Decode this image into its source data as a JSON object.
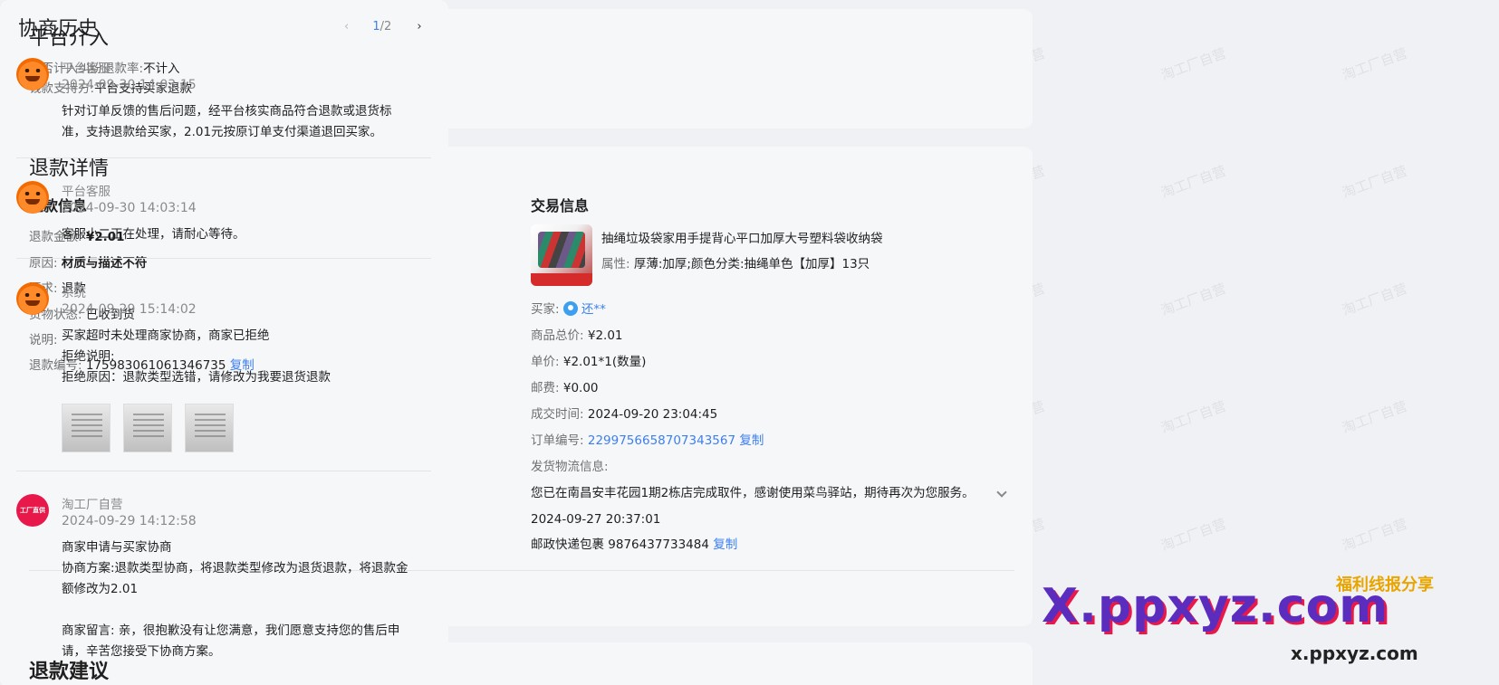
{
  "platform": {
    "title": "平台介入",
    "rows": [
      {
        "label": "是否计入纠纷退款率:",
        "value": "不计入"
      },
      {
        "label": "钱款支持方:",
        "value": "平台支持买家退款"
      }
    ]
  },
  "refund": {
    "title": "退款详情",
    "info_title": "退款信息",
    "info": {
      "amount_label": "退款金额:",
      "amount": "¥2.01",
      "reason_label": "原因:",
      "reason": "材质与描述不符",
      "request_label": "要求:",
      "request": "退款",
      "goods_label": "货物状态:",
      "goods": "已收到货",
      "note_label": "说明:",
      "note": "",
      "refund_no_label": "退款编号:",
      "refund_no": "175983061061346735",
      "copy": "复制"
    },
    "trade_title": "交易信息",
    "trade": {
      "product_name": "抽绳垃圾袋家用手提背心平口加厚大号塑料袋收纳袋",
      "attr_label": "属性:",
      "attr": "厚薄:加厚;颜色分类:抽绳单色【加厚】13只",
      "buyer_label": "买家:",
      "buyer": "还**",
      "total_label": "商品总价:",
      "total": "¥2.01",
      "unit_label": "单价:",
      "unit": "¥2.01*1(数量)",
      "shipping_label": "邮费:",
      "shipping": "¥0.00",
      "deal_time_label": "成交时间:",
      "deal_time": "2024-09-20 23:04:45",
      "order_no_label": "订单编号:",
      "order_no": "2299756658707343567",
      "copy": "复制",
      "logistics_label": "发货物流信息:",
      "logistics_msg": "您已在南昌安丰花园1期2栋店完成取件，感谢使用菜鸟驿站，期待再次为您服务。",
      "logistics_time": "2024-09-27 20:37:01",
      "tracking": "邮政快递包裹 9876437733484",
      "tracking_copy": "复制"
    }
  },
  "advice": {
    "title": "退款建议"
  },
  "history": {
    "title": "协商历史",
    "pager": {
      "prev": "‹",
      "current": "1",
      "total": "/2",
      "next": "›"
    },
    "items": [
      {
        "name": "平台客服",
        "time": "2024-09-30 14:03:15",
        "text1": "针对订单反馈的售后问题，经平台核实商品符合退款或退货标",
        "text2": "准，支持退款给买家，2.01元按原订单支付渠道退回买家。"
      },
      {
        "name": "平台客服",
        "time": "2024-09-30 14:03:14",
        "text1": "客服小二正在处理，请耐心等待。"
      },
      {
        "name": "系统",
        "time": "2024-09-29 15:14:02",
        "text1": "买家超时未处理商家协商，商家已拒绝",
        "text2": "拒绝说明:",
        "text3": "拒绝原因：退款类型选错，请修改为我要退货退款"
      },
      {
        "name": "淘工厂自营",
        "time": "2024-09-29 14:12:58",
        "text1": "商家申请与买家协商",
        "text2": "协商方案:退款类型协商，将退款类型修改为退货退款，将退款金",
        "text3": "额修改为2.01",
        "text4": "商家留言: 亲，很抱歉没有让您满意，我们愿意支持您的售后申",
        "text5": "请，辛苦您接受下协商方案。"
      }
    ],
    "shop_avatar_text": "工厂直供"
  },
  "watermark_text": "淘工厂自营",
  "overlay": {
    "brand": "X.ppxyz.com",
    "sub": "x.ppxyz.com",
    "tag": "福利线报分享"
  },
  "colors": {
    "link": "#3c7ff0",
    "card": "#f6f7f9",
    "bg": "#f0f1f5"
  }
}
